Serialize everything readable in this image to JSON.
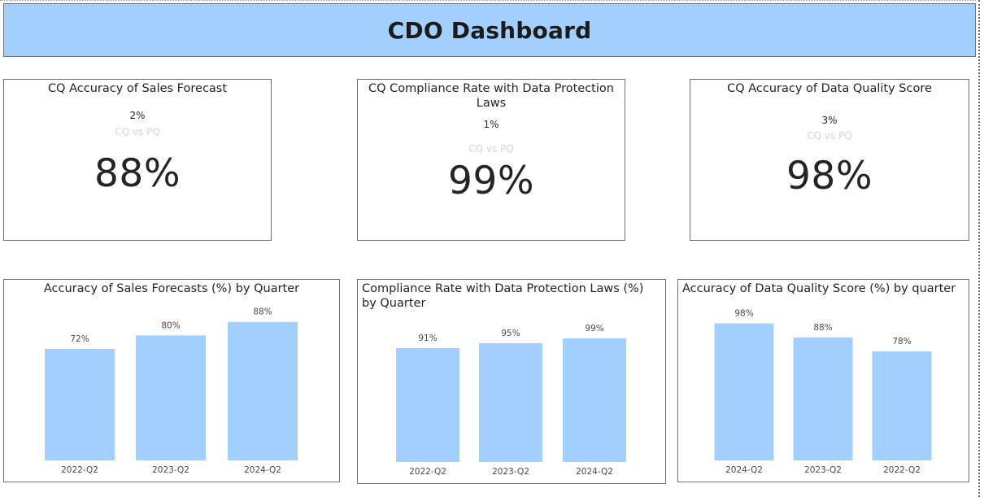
{
  "header": {
    "title": "CDO Dashboard"
  },
  "kpis": [
    {
      "title": "CQ Accuracy of Sales Forecast",
      "delta": "2%",
      "comparison": "CQ vs PQ",
      "value": "88%"
    },
    {
      "title": "CQ Compliance Rate with Data Protection Laws",
      "delta": "1%",
      "comparison": "CQ vs PQ",
      "value": "99%"
    },
    {
      "title": "CQ Accuracy of Data Quality Score",
      "delta": "3%",
      "comparison": "CQ vs PQ",
      "value": "98%"
    }
  ],
  "colors": {
    "bar": "#a2cffe",
    "header": "#a2cffe"
  },
  "chart_data": [
    {
      "type": "bar",
      "title": "Accuracy of Sales Forecasts (%) by Quarter",
      "categories": [
        "2022-Q2",
        "2023-Q2",
        "2024-Q2"
      ],
      "values": [
        72,
        80,
        88
      ],
      "labels": [
        "72%",
        "80%",
        "88%"
      ],
      "ylim": [
        0,
        100
      ]
    },
    {
      "type": "bar",
      "title": "Compliance Rate with Data Protection Laws (%) by Quarter",
      "categories": [
        "2022-Q2",
        "2023-Q2",
        "2024-Q2"
      ],
      "values": [
        91,
        95,
        99
      ],
      "labels": [
        "91%",
        "95%",
        "99%"
      ],
      "ylim": [
        0,
        100
      ]
    },
    {
      "type": "bar",
      "title": "Accuracy of Data Quality Score (%) by quarter",
      "categories": [
        "2024-Q2",
        "2023-Q2",
        "2022-Q2"
      ],
      "values": [
        98,
        88,
        78
      ],
      "labels": [
        "98%",
        "88%",
        "78%"
      ],
      "ylim": [
        0,
        100
      ]
    }
  ]
}
